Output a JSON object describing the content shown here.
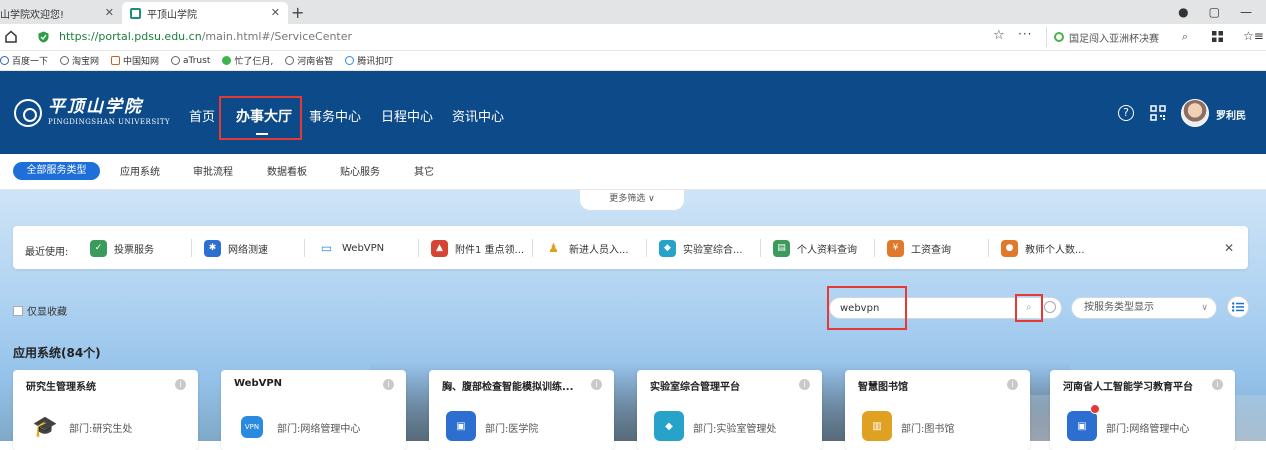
{
  "browser": {
    "tabs": [
      {
        "title": "山学院欢迎您!"
      },
      {
        "title": "平顶山学院"
      }
    ],
    "url_host": "https://portal.pdsu.edu.cn",
    "url_path": "/main.html#/ServiceCenter",
    "search_text": "国足闯入亚洲杯决赛",
    "bookmarks": [
      "百度一下",
      "淘宝网",
      "中国知网",
      "aTrust",
      "忙了仨月,",
      "河南省智",
      "腾讯扣叮"
    ]
  },
  "header": {
    "logo_cn": "平顶山学院",
    "logo_en": "PINGDINGSHAN UNIVERSITY",
    "nav": [
      "首页",
      "办事大厅",
      "事务中心",
      "日程中心",
      "资讯中心"
    ],
    "user": "罗利民"
  },
  "categories": [
    "全部服务类型",
    "应用系统",
    "审批流程",
    "数据看板",
    "贴心服务",
    "其它"
  ],
  "more_filter": "更多筛选",
  "recent": {
    "label": "最近使用:",
    "items": [
      "投票服务",
      "网络测速",
      "WebVPN",
      "附件1 重点领...",
      "新进人员入...",
      "实验室综合...",
      "个人资料查询",
      "工资查询",
      "教师个人数..."
    ]
  },
  "filters": {
    "favorites_only": "仅显收藏",
    "search_value": "webvpn",
    "type_select": "按服务类型显示"
  },
  "section": {
    "title": "应用系统(84个)"
  },
  "cards": [
    {
      "title": "研究生管理系统",
      "dept": "部门:研究生处"
    },
    {
      "title": "WebVPN",
      "dept": "部门:网络管理中心"
    },
    {
      "title": "胸、腹部检查智能模拟训练...",
      "dept": "部门:医学院"
    },
    {
      "title": "实验室综合管理平台",
      "dept": "部门:实验室管理处"
    },
    {
      "title": "智慧图书馆",
      "dept": "部门:图书馆"
    },
    {
      "title": "河南省人工智能学习教育平台",
      "dept": "部门:网络管理中心"
    }
  ],
  "colors": {
    "header": "#0c4a8a",
    "accent": "#1e6fd9",
    "highlight": "#e53935"
  }
}
